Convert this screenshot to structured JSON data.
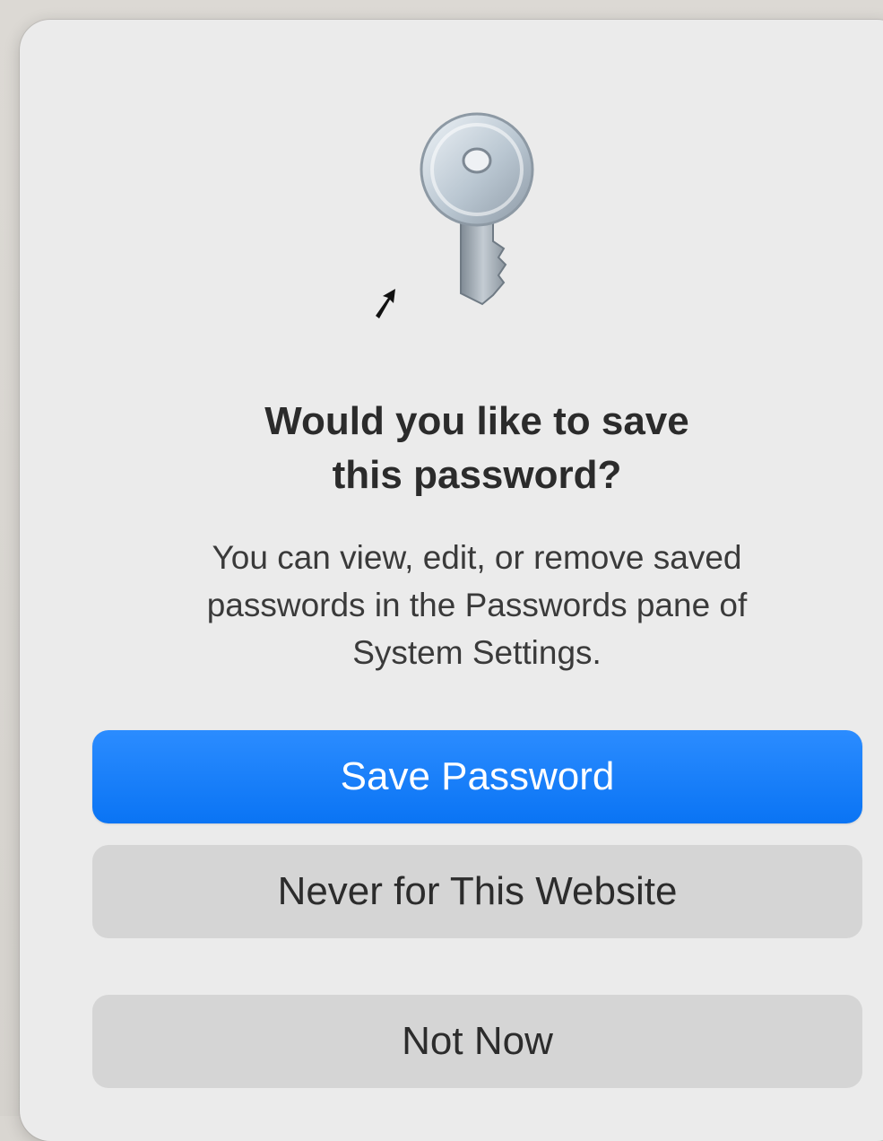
{
  "dialog": {
    "title_line1": "Would you like to save",
    "title_line2": "this password?",
    "message_line1": "You can view, edit, or remove saved",
    "message_line2": "passwords in the Passwords pane of",
    "message_line3": "System Settings.",
    "icon": "key-icon"
  },
  "buttons": {
    "save": "Save Password",
    "never": "Never for This Website",
    "not_now": "Not Now"
  },
  "colors": {
    "accent": "#0a74f4",
    "dialog_background": "#ebebeb",
    "secondary_button": "#d5d5d5"
  }
}
